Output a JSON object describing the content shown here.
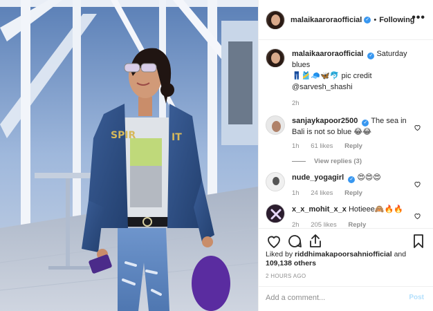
{
  "post": {
    "author": "malaikaaroraofficial",
    "follow_dot": "•",
    "follow_label": "Following",
    "more_label": "•••",
    "verified_mark": "✓",
    "caption_text": "Saturday blues",
    "caption_emojis": "👖🎽🧢🦋🐬 pic credit",
    "caption_credit": "@sarvesh_shashi",
    "caption_time": "2h"
  },
  "comments": [
    {
      "user": "sanjaykapoor2500",
      "verified": true,
      "text": "The sea in Bali is not so blue 😂😂",
      "time": "1h",
      "likes": "61 likes",
      "reply_label": "Reply",
      "view_replies": "View replies (3)"
    },
    {
      "user": "nude_yogagirl",
      "verified": true,
      "text": "😍😍😍",
      "time": "1h",
      "likes": "24 likes",
      "reply_label": "Reply"
    },
    {
      "user": "x_x_mohit_x_x",
      "verified": false,
      "text": "Hotieee🙈🔥🔥",
      "time": "2h",
      "likes": "205 likes",
      "reply_label": "Reply"
    }
  ],
  "actions": {
    "liked_by_prefix": "Liked by",
    "liked_by_user": "riddhimakapoorsahniofficial",
    "liked_by_and": "and",
    "liked_by_others": "109,138 others",
    "time_ago": "2 HOURS AGO",
    "comment_placeholder": "Add a comment...",
    "post_label": "Post",
    "icons": [
      "heart-icon",
      "comment-icon",
      "share-icon",
      "bookmark-icon"
    ]
  },
  "colors": {
    "verified": "#3897f0",
    "muted": "#8e8e8e",
    "post_button": "#b2dffc"
  }
}
